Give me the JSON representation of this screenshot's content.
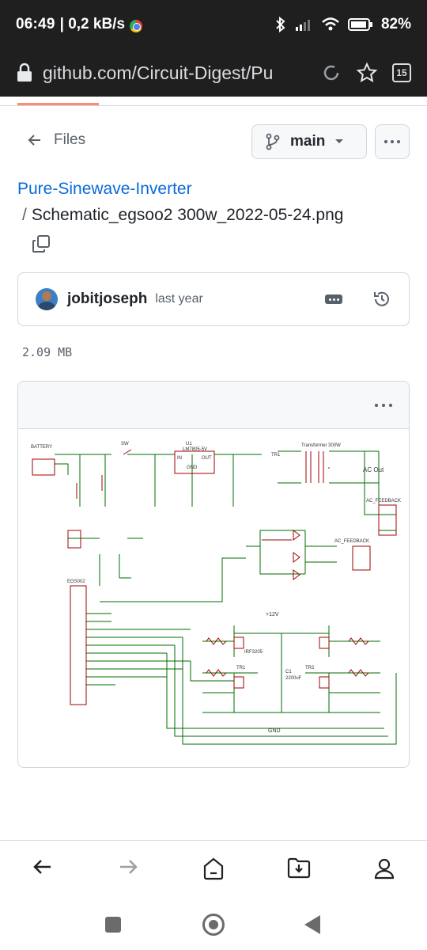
{
  "status_bar": {
    "time": "06:49",
    "speed": "| 0,2 kB/s",
    "battery": "82%"
  },
  "browser": {
    "url": "github.com/Circuit-Digest/Pu",
    "tab_count": "15"
  },
  "nav": {
    "files_label": "Files",
    "branch": "main"
  },
  "breadcrumb": {
    "repo": "Pure-Sinewave-Inverter",
    "separator": "/",
    "filename": "Schematic_egsoo2 300w_2022-05-24.png"
  },
  "commit": {
    "author": "jobitjoseph",
    "time": "last year"
  },
  "file": {
    "size": "2.09 MB"
  },
  "schematic_labels": {
    "battery": "BATTERY",
    "sw": "SW",
    "u1": "U1",
    "lm": "LM7805-5V",
    "in": "IN",
    "out": "OUT",
    "gnd": "GND",
    "tr1": "TR1",
    "transformer": "Transformer 300W",
    "ac_out": "AC Out",
    "ac_feedback": "AC_FEEDBACK",
    "egs002": "EGS002",
    "v12": "+12V",
    "tr2": "TR2",
    "c1": "C1",
    "c1_val": "2200uF",
    "q1": "IRF3205",
    "tr1b": "TR1"
  },
  "colors": {
    "link": "#0969da",
    "wire": "#006c00",
    "component": "#a00000"
  }
}
